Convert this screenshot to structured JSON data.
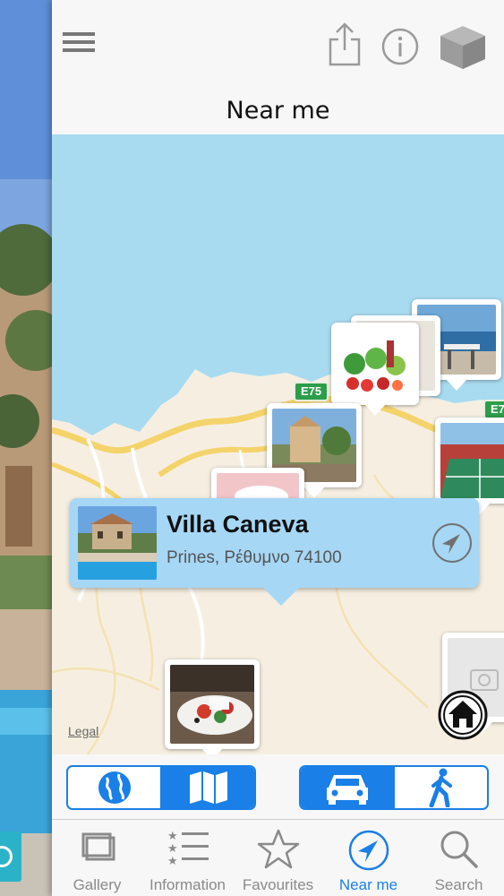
{
  "header": {
    "title": "Near me"
  },
  "map": {
    "legal_label": "Legal",
    "road_badges": [
      "E75",
      "E7"
    ],
    "callout": {
      "name": "Villa Caneva",
      "address": "Prines, Ρέθυμνο 74100"
    }
  },
  "controls": {
    "map_type": {
      "options": [
        "globe-icon",
        "map-icon"
      ],
      "selected": "map-icon"
    },
    "travel_mode": {
      "options": [
        "car-icon",
        "walking-icon"
      ],
      "selected": "car-icon"
    }
  },
  "tabbar": {
    "tabs": [
      {
        "label": "Gallery",
        "icon": "gallery-icon",
        "active": false
      },
      {
        "label": "Information",
        "icon": "list-icon",
        "active": false
      },
      {
        "label": "Favourites",
        "icon": "star-icon",
        "active": false
      },
      {
        "label": "Near me",
        "icon": "location-arrow-icon",
        "active": true
      },
      {
        "label": "Search",
        "icon": "search-icon",
        "active": false
      }
    ]
  },
  "colors": {
    "accent": "#1a7fe6",
    "callout_background": "#a6d7f5",
    "sea": "#a8dbf0",
    "land": "#f6efe1",
    "road_badge": "#2c9e4a"
  }
}
